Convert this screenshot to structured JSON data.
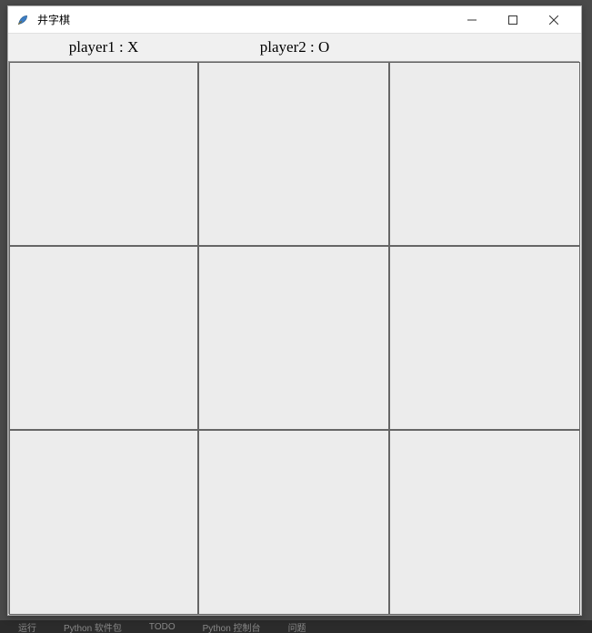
{
  "window": {
    "title": "井字棋",
    "minimize_label": "—",
    "maximize_label": "☐",
    "close_label": "✕"
  },
  "header": {
    "player1_label": "player1 : X",
    "player2_label": "player2 : O"
  },
  "board": {
    "cells": [
      "",
      "",
      "",
      "",
      "",
      "",
      "",
      "",
      ""
    ]
  },
  "background": {
    "item1": "运行",
    "item2": "Python 软件包",
    "item3": "TODO",
    "item4": "Python 控制台",
    "item5": "问题"
  }
}
